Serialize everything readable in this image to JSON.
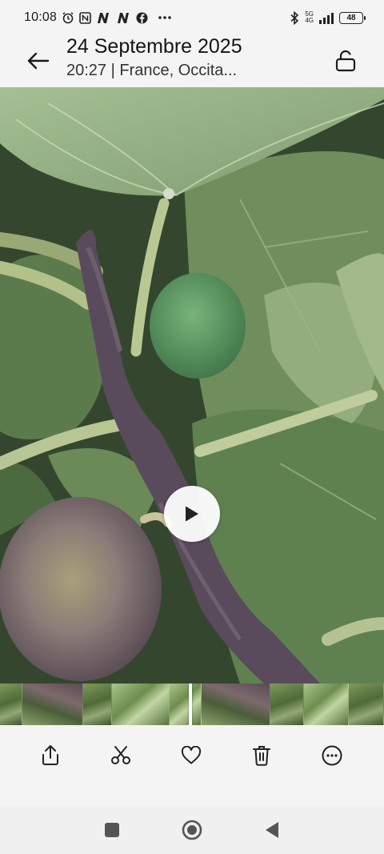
{
  "status_bar": {
    "time": "10:08",
    "icons": [
      "alarm-icon",
      "nfc-icon",
      "notification-n-icon",
      "notification-n-icon",
      "facebook-icon",
      "more-dots-icon"
    ],
    "network_top": "5G",
    "network_bottom": "4G",
    "battery": "48"
  },
  "header": {
    "title": "24 Septembre 2025",
    "subtitle": "20:27 | France, Occita..."
  },
  "media": {
    "kind": "video",
    "play_icon": "play-icon"
  },
  "toolbar": {
    "actions": [
      {
        "name": "share",
        "icon": "share-icon"
      },
      {
        "name": "edit",
        "icon": "scissors-icon"
      },
      {
        "name": "favorite",
        "icon": "heart-icon"
      },
      {
        "name": "delete",
        "icon": "trash-icon"
      },
      {
        "name": "more",
        "icon": "more-icon"
      }
    ]
  },
  "nav": {
    "buttons": [
      "recents-icon",
      "home-icon",
      "back-icon"
    ]
  },
  "colors": {
    "background": "#f4f4f4",
    "leaf": "#6f8f57",
    "fig_purple": "#6b5a66",
    "fig_green": "#5f9a62"
  }
}
